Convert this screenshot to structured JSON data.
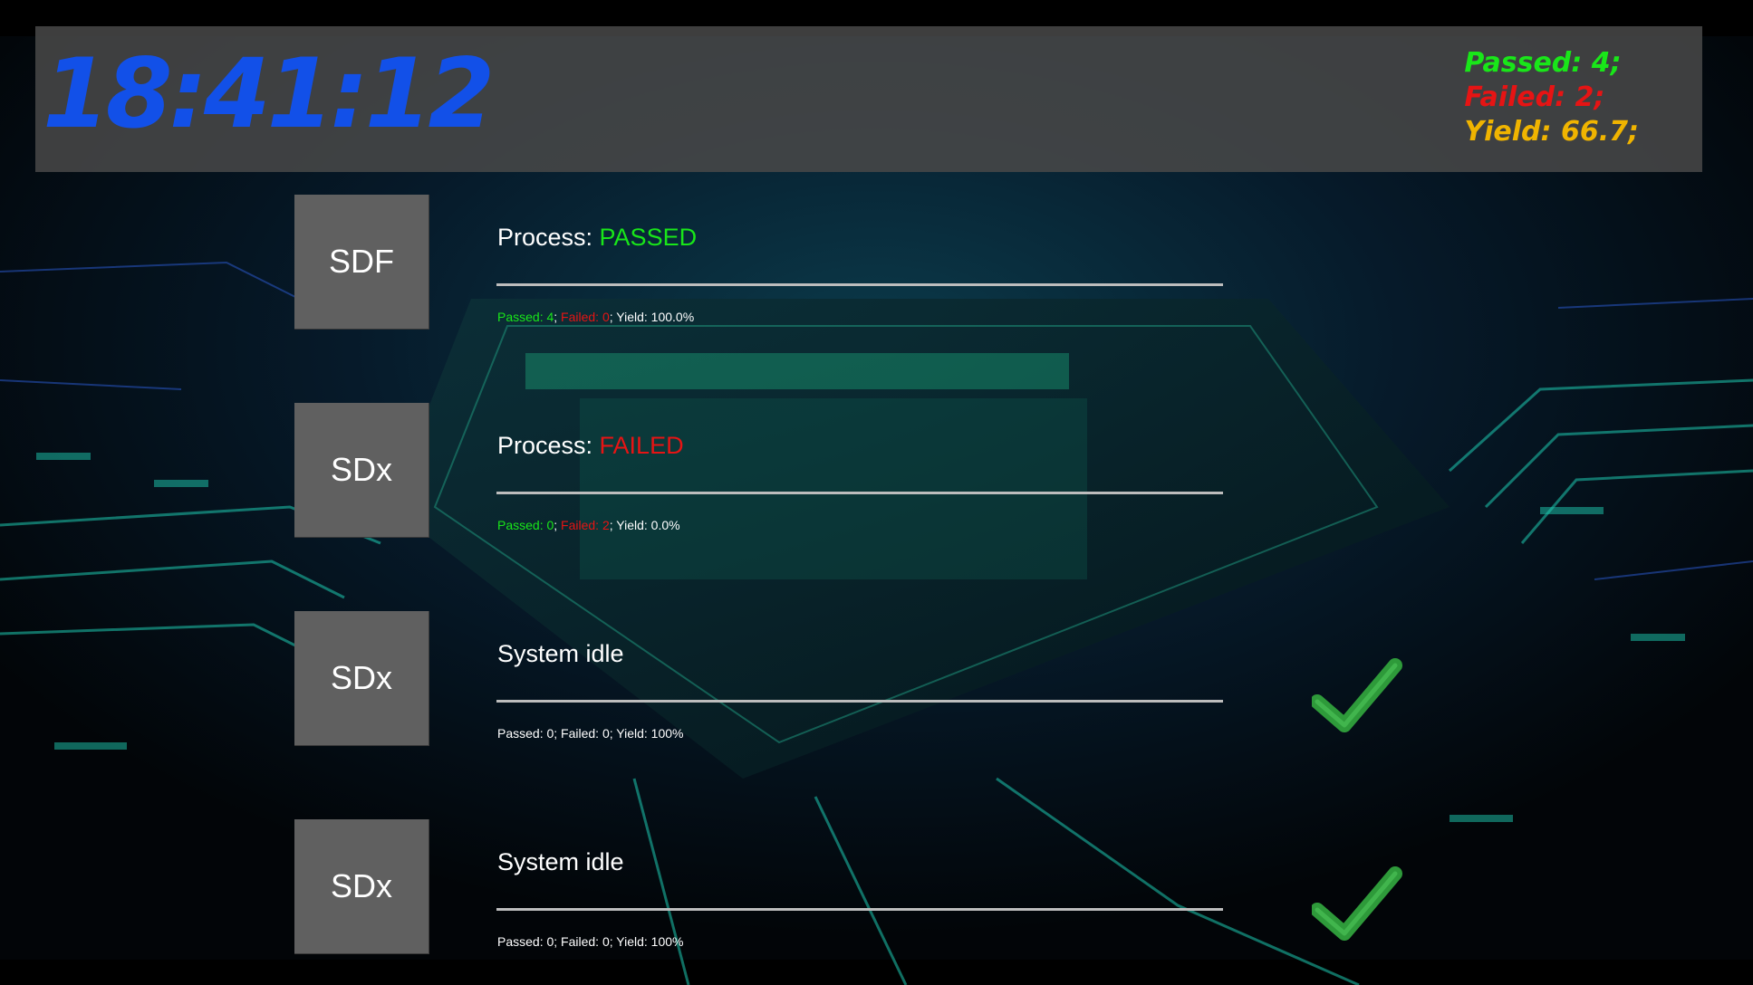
{
  "header": {
    "clock": "18:41:12",
    "totals": {
      "passed": "Passed: 4;",
      "failed": "Failed: 2;",
      "yield": "Yield: 66.7;"
    }
  },
  "stations": [
    {
      "name": "SDF",
      "status_prefix": "Process: ",
      "status_state": "PASSED",
      "state_color": "#19e619",
      "stats": {
        "passed": "Passed: 4",
        "sep1": "; ",
        "failed": "Failed: 0",
        "rest": "; Yield: 100.0%"
      },
      "show_check": false
    },
    {
      "name": "SDx",
      "status_prefix": "Process: ",
      "status_state": "FAILED",
      "state_color": "#e61414",
      "stats": {
        "passed": "Passed: 0",
        "sep1": "; ",
        "failed": "Failed: 2",
        "rest": "; Yield: 0.0%"
      },
      "show_check": false
    },
    {
      "name": "SDx",
      "status_prefix": "System idle",
      "status_state": "",
      "stats_plain": "Passed: 0; Failed: 0; Yield: 100%",
      "show_check": true,
      "check_icon": "checkmark-icon"
    },
    {
      "name": "SDx",
      "status_prefix": "System idle",
      "status_state": "",
      "stats_plain": "Passed: 0; Failed: 0; Yield: 100%",
      "show_check": true,
      "check_icon": "checkmark-icon"
    }
  ],
  "colors": {
    "clock": "#1250e8",
    "passed": "#19e619",
    "failed": "#e61414",
    "yield": "#f0b400",
    "check": "#2e9a3a"
  },
  "background_icon": "circuit-board-background"
}
